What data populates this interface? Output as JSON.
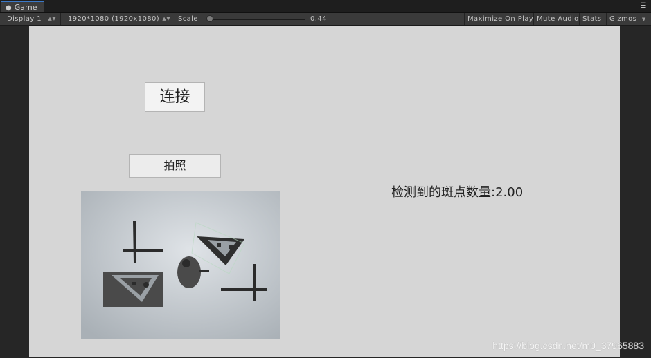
{
  "tab": {
    "icon": "game-controller-icon",
    "label": "Game"
  },
  "toolbar": {
    "display_label": "Display 1",
    "resolution_label": "1920*1080 (1920x1080)",
    "scale_label": "Scale",
    "scale_value": "0.44",
    "scale_level": 0.02,
    "maximize_label": "Maximize On Play",
    "mute_label": "Mute Audio",
    "stats_label": "Stats",
    "gizmos_label": "Gizmos"
  },
  "game": {
    "connect_label": "连接",
    "photo_label": "拍照",
    "blob_count_label": "检测到的斑点数量:2.00"
  },
  "colors": {
    "viewport_bg": "#d6d6d6",
    "editor_bg": "#262626",
    "toolbar_bg": "#3a3a3a",
    "tab_accent": "#3a78c8"
  },
  "watermark": "https://blog.csdn.net/m0_37965883"
}
